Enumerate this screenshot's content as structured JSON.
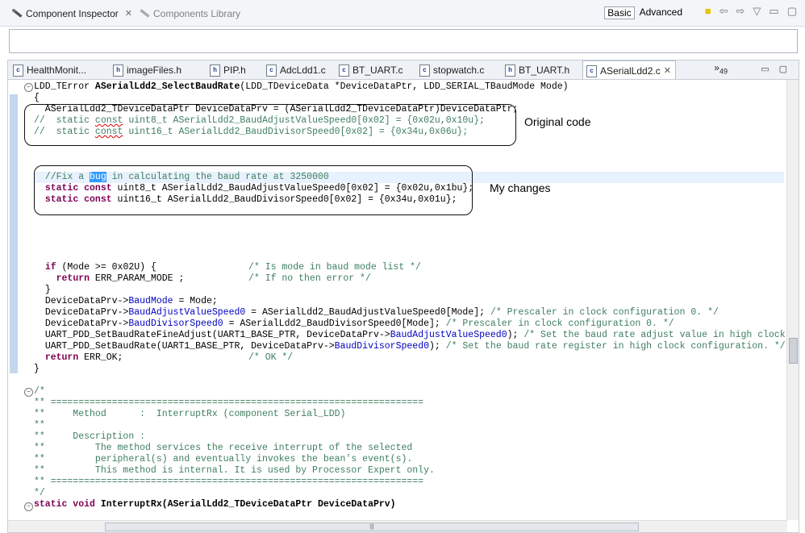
{
  "inspector": {
    "tab1_label": "Component Inspector",
    "tab2_label": "Components Library",
    "basic_label": "Basic",
    "advanced_label": "Advanced"
  },
  "editor_tabs": [
    {
      "label": "HealthMonit..."
    },
    {
      "label": "imageFiles.h"
    },
    {
      "label": "PIP.h"
    },
    {
      "label": "AdcLdd1.c"
    },
    {
      "label": "BT_UART.c"
    },
    {
      "label": "stopwatch.c"
    },
    {
      "label": "BT_UART.h"
    },
    {
      "label": "ASerialLdd2.c"
    }
  ],
  "overflow_count": "49",
  "annotations": {
    "original": "Original code",
    "changes": "My changes"
  },
  "code": {
    "l1_kw": "LDD_TError",
    "l1_fn": "ASerialLdd2_SelectBaudRate",
    "l1_args": "(LDD_TDeviceData *DeviceDataPtr, LDD_SERIAL_TBaudMode Mode)",
    "l2": "{",
    "l3": "  ASerialLdd2_TDeviceDataPtr DeviceDataPrv = (ASerialLdd2_TDeviceDataPtr)DeviceDataPtr;",
    "l4a": "//  static ",
    "l4b": "const",
    "l4c": " uint8_t ASerialLdd2_BaudAdjustValueSpeed0[0x02] = {0x02u,0x10u};",
    "l5a": "//  static ",
    "l5b": "const",
    "l5c": " uint16_t ASerialLdd2_BaudDivisorSpeed0[0x02] = {0x34u,0x06u};",
    "l6a": "  //Fix a ",
    "l6b": "bug",
    "l6c": " in calculating the baud rate at 3250000",
    "l7kw": "static const",
    "l7": " uint8_t ASerialLdd2_BaudAdjustValueSpeed0[0x02] = {0x02u,0x1bu};",
    "l8kw": "static const",
    "l8": " uint16_t ASerialLdd2_BaudDivisorSpeed0[0x02] = {0x34u,0x01u};",
    "l9kw": "if",
    "l9": " (Mode >= 0x02U) {",
    "l9c": "/* Is mode in baud mode list */",
    "l10kw": "return",
    "l10": " ERR_PARAM_MODE ;",
    "l10c": "/* If no then error */",
    "l11": "}",
    "l12a": "DeviceDataPrv->",
    "l12b": "BaudMode",
    "l12c": " = Mode;",
    "l13a": "DeviceDataPrv->",
    "l13b": "BaudAdjustValueSpeed0",
    "l13c": " = ASerialLdd2_BaudAdjustValueSpeed0[Mode]; ",
    "l13d": "/* Prescaler in clock configuration 0. */",
    "l14a": "DeviceDataPrv->",
    "l14b": "BaudDivisorSpeed0",
    "l14c": " = ASerialLdd2_BaudDivisorSpeed0[Mode]; ",
    "l14d": "/* Prescaler in clock configuration 0. */",
    "l15a": "UART_PDD_SetBaudRateFineAdjust(UART1_BASE_PTR, DeviceDataPrv->",
    "l15b": "BaudAdjustValueSpeed0",
    "l15c": "); ",
    "l15d": "/* Set the baud rate adjust value in high clock con",
    "l16a": "UART_PDD_SetBaudRate(UART1_BASE_PTR, DeviceDataPrv->",
    "l16b": "BaudDivisorSpeed0",
    "l16c": "); ",
    "l16d": "/* Set the baud rate register in high clock configuration. */",
    "l17kw": "return",
    "l17": " ERR_OK;",
    "l17c": "/* OK */",
    "l18": "}",
    "c1": "/*",
    "c2": "** ===================================================================",
    "c3": "**     Method      :  InterruptRx (component Serial_LDD)",
    "c4": "**",
    "c5": "**     Description :",
    "c6": "**         The method services the receive interrupt of the selected",
    "c7": "**         peripheral(s) and eventually invokes the bean's event(s).",
    "c8": "**         This method is internal. It is used by Processor Expert only.",
    "c9": "** ===================================================================",
    "c10": "*/",
    "last_kw": "static void",
    "last": " InterruptRx(ASerialLdd2_TDeviceDataPtr DeviceDataPrv)"
  }
}
